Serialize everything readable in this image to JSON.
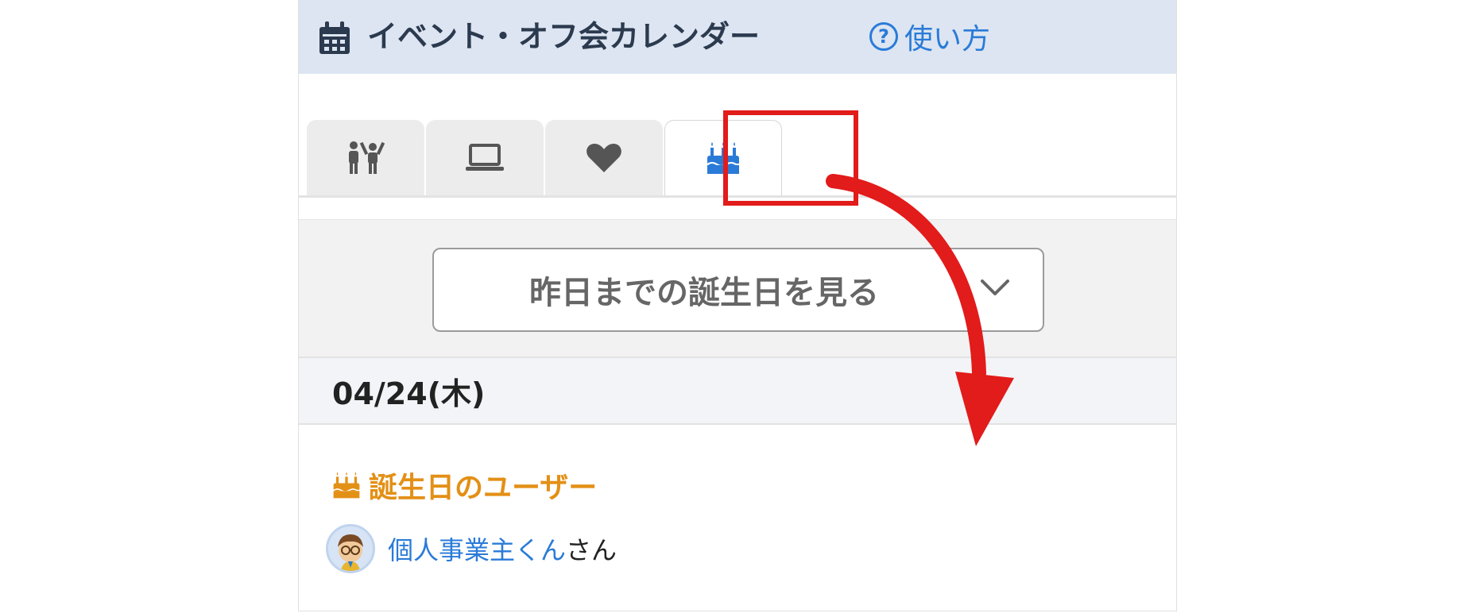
{
  "header": {
    "title": "イベント・オフ会カレンダー",
    "help_label": "使い方",
    "help_icon_text": "?"
  },
  "tabs": [
    {
      "icon": "people-icon",
      "active": false
    },
    {
      "icon": "laptop-icon",
      "active": false
    },
    {
      "icon": "heart-icon",
      "active": false
    },
    {
      "icon": "birthday-cake-icon",
      "active": true
    }
  ],
  "filter": {
    "dropdown_label": "昨日までの誕生日を見る"
  },
  "date_heading": "04/24(木)",
  "birthday_section": {
    "title": "誕生日のユーザー"
  },
  "user": {
    "name": "個人事業主くん",
    "suffix": "さん"
  },
  "colors": {
    "header_bg": "#dce5f1",
    "accent_blue": "#2a7bd8",
    "accent_orange": "#e39016",
    "highlight_red": "#e21b1b"
  }
}
